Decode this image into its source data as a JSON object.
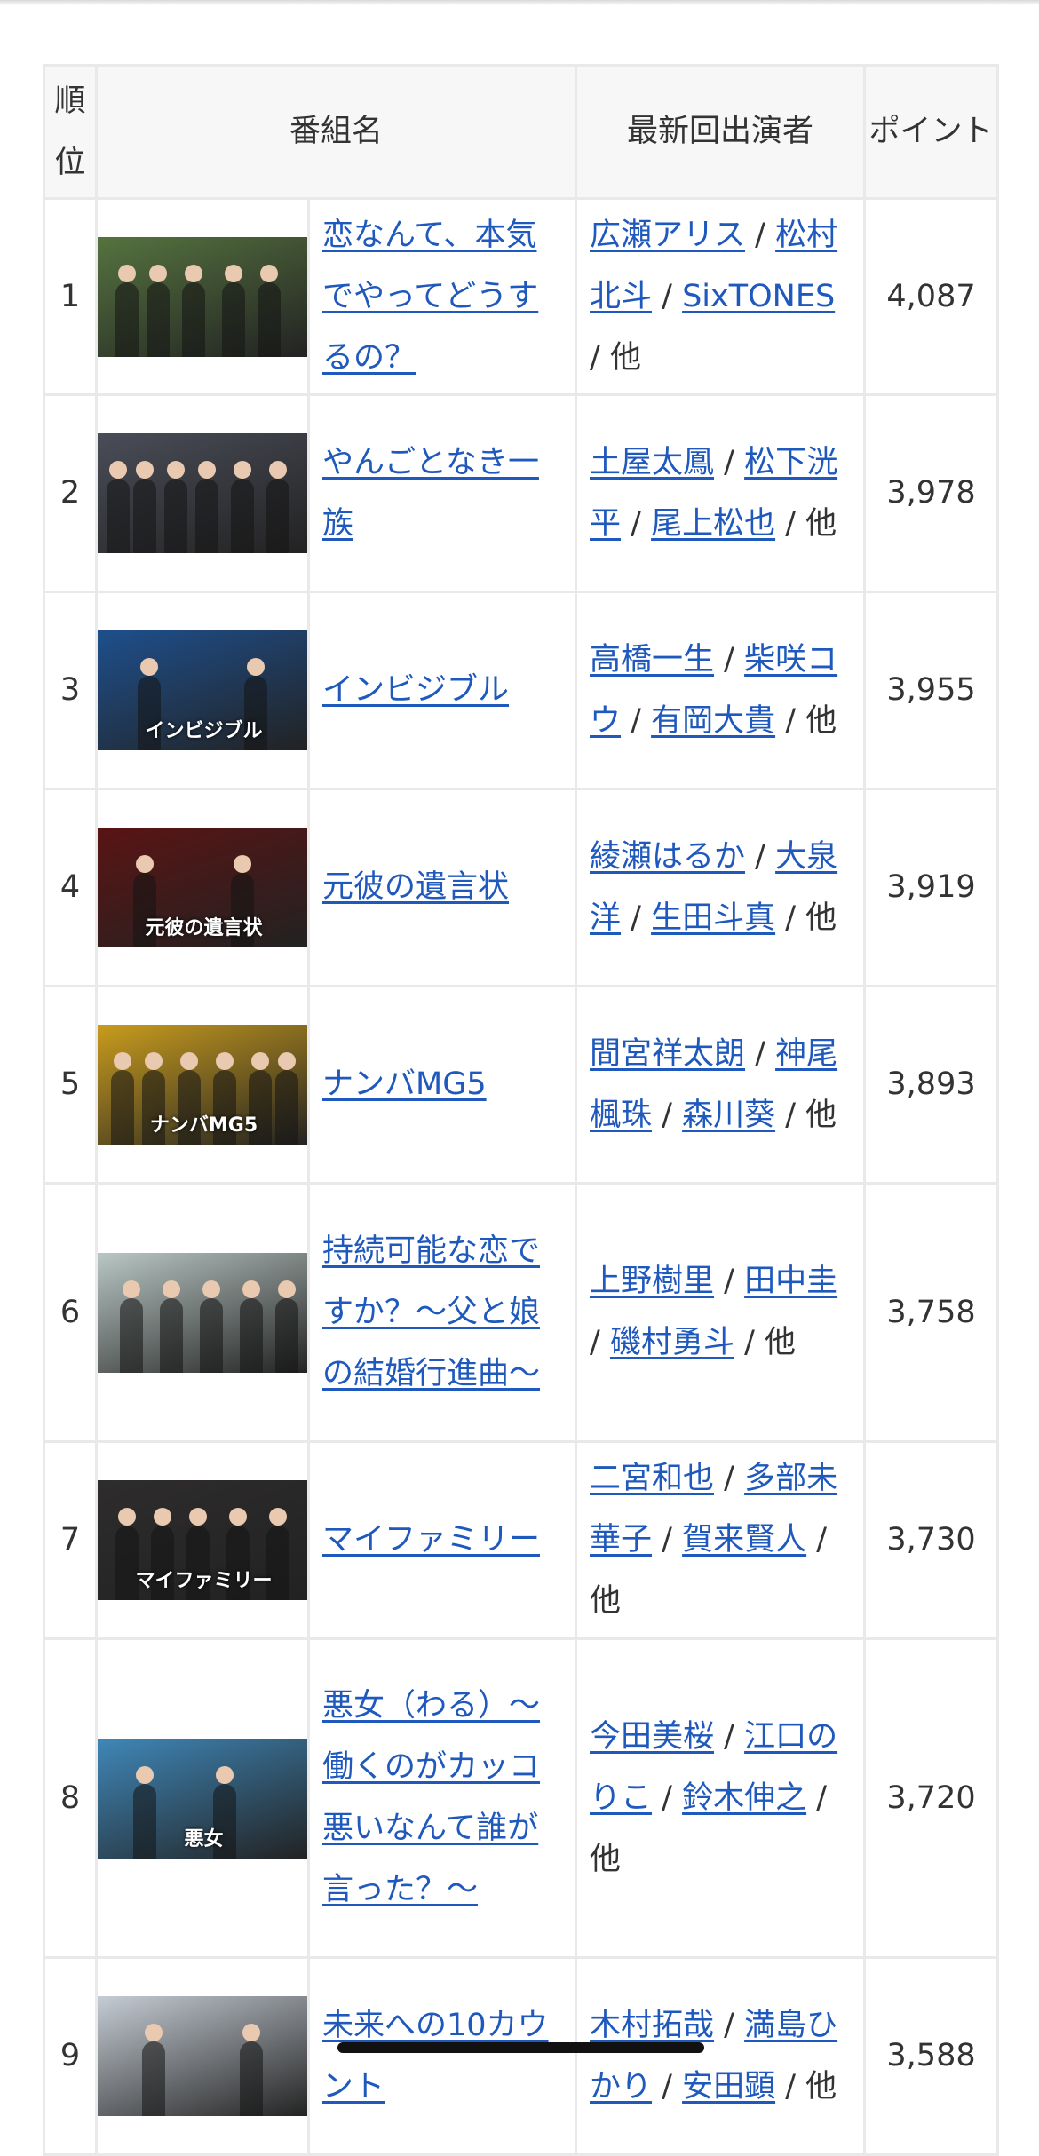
{
  "table": {
    "headers": {
      "rank": "順位",
      "title": "番組名",
      "cast": "最新回出演者",
      "points": "ポイント"
    },
    "rows": [
      {
        "rank": "1",
        "title": "恋なんて、本気でやってどうするの？",
        "cast": [
          "広瀬アリス",
          "松村北斗",
          "SixTONES"
        ],
        "other": "他",
        "points": "4,087",
        "thumb_color": "#55733f",
        "thumb_caption": ""
      },
      {
        "rank": "2",
        "title": "やんごとなき一族",
        "cast": [
          "土屋太鳳",
          "松下洸平",
          "尾上松也"
        ],
        "other": "他",
        "points": "3,978",
        "thumb_color": "#4a4d58",
        "thumb_caption": ""
      },
      {
        "rank": "3",
        "title": "インビジブル",
        "cast": [
          "高橋一生",
          "柴咲コウ",
          "有岡大貴"
        ],
        "other": "他",
        "points": "3,955",
        "thumb_color": "#1e4f8c",
        "thumb_caption": "インビジブル"
      },
      {
        "rank": "4",
        "title": "元彼の遺言状",
        "cast": [
          "綾瀬はるか",
          "大泉洋",
          "生田斗真"
        ],
        "other": "他",
        "points": "3,919",
        "thumb_color": "#5a1414",
        "thumb_caption": "元彼の遺言状"
      },
      {
        "rank": "5",
        "title": "ナンバMG5",
        "cast": [
          "間宮祥太朗",
          "神尾楓珠",
          "森川葵"
        ],
        "other": "他",
        "points": "3,893",
        "thumb_color": "#c99c1e",
        "thumb_caption": "ナンバMG5"
      },
      {
        "rank": "6",
        "title": "持続可能な恋ですか？〜父と娘の結婚行進曲〜",
        "cast": [
          "上野樹里",
          "田中圭",
          "磯村勇斗"
        ],
        "other": "他",
        "points": "3,758",
        "thumb_color": "#b9c7c4",
        "thumb_caption": ""
      },
      {
        "rank": "7",
        "title": "マイファミリー",
        "cast": [
          "二宮和也",
          "多部未華子",
          "賀来賢人"
        ],
        "other": "他",
        "points": "3,730",
        "thumb_color": "#2e2c2c",
        "thumb_caption": "マイファミリー"
      },
      {
        "rank": "8",
        "title": "悪女（わる）〜働くのがカッコ悪いなんて誰が言った？〜",
        "cast": [
          "今田美桜",
          "江口のりこ",
          "鈴木伸之"
        ],
        "other": "他",
        "points": "3,720",
        "thumb_color": "#3f87b8",
        "thumb_caption": "悪女"
      },
      {
        "rank": "9",
        "title": "未来への10カウント",
        "cast": [
          "木村拓哉",
          "満島ひかり",
          "安田顕"
        ],
        "other": "他",
        "points": "3,588",
        "thumb_color": "#c5ccd4",
        "thumb_caption": ""
      }
    ]
  }
}
